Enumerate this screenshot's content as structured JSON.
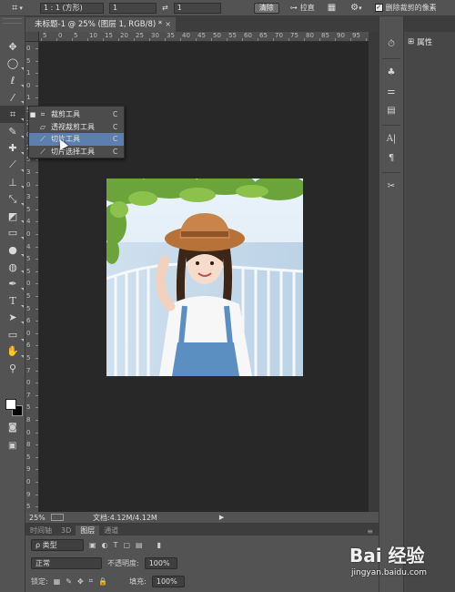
{
  "options_bar": {
    "ratio_value": "1 : 1 (方形)",
    "width_value": "1",
    "height_value": "1",
    "clear_label": "清除",
    "straighten_label": "拉直",
    "delete_cropped_label": "删除裁剪的像素"
  },
  "document": {
    "tab_title": "未标题-1 @ 25% (图层 1, RGB/8) *",
    "close_glyph": "×"
  },
  "rulers": {
    "horizontal": [
      "5",
      "0",
      "5",
      "10",
      "15",
      "20",
      "25",
      "30",
      "35",
      "40",
      "45",
      "50",
      "55",
      "60",
      "65",
      "70",
      "75",
      "80",
      "85",
      "90",
      "95",
      "100"
    ],
    "vertical": [
      "0",
      "5",
      "1",
      "0",
      "1",
      "5",
      "2",
      "0",
      "2",
      "5",
      "3",
      "0",
      "3",
      "5",
      "4",
      "0",
      "4",
      "5",
      "5",
      "0",
      "5",
      "5",
      "6",
      "0",
      "6",
      "5",
      "7",
      "0",
      "7",
      "5",
      "8",
      "0",
      "8",
      "5",
      "9",
      "0",
      "9",
      "5"
    ]
  },
  "flyout": {
    "items": [
      {
        "label": "裁剪工具",
        "key": "C",
        "selected": true
      },
      {
        "label": "透视裁剪工具",
        "key": "C",
        "selected": false
      },
      {
        "label": "切片工具",
        "key": "C",
        "selected": false
      },
      {
        "label": "切片选择工具",
        "key": "C",
        "selected": false
      }
    ]
  },
  "status": {
    "zoom": "25%",
    "doc_info": "文档:4.12M/4.12M",
    "arrow": "▶"
  },
  "bottom_panel": {
    "tabs": [
      "时间轴",
      "3D",
      "图层",
      "通道"
    ],
    "active_tab": "图层",
    "kind_label": "ρ 类型",
    "blend_mode": "正常",
    "opacity_label": "不透明度:",
    "opacity_value": "100%",
    "lock_label": "锁定:",
    "fill_label": "填充:",
    "fill_value": "100%"
  },
  "right_panel": {
    "properties_label": "属性"
  },
  "watermark": {
    "logo": "Bai 经验",
    "url": "jingyan.baidu.com"
  },
  "colors": {
    "foreground": "#ffffff",
    "background": "#000000",
    "canvas": "#282828",
    "highlight": "#5c7fb0"
  },
  "icons": {
    "toolbar": [
      "move-icon",
      "marquee-icon",
      "lasso-icon",
      "quick-select-icon",
      "crop-icon",
      "eyedropper-icon",
      "healing-icon",
      "brush-icon",
      "stamp-icon",
      "history-brush-icon",
      "eraser-icon",
      "gradient-icon",
      "blur-icon",
      "dodge-icon",
      "pen-icon",
      "type-icon",
      "path-select-icon",
      "rectangle-icon",
      "hand-icon",
      "zoom-icon"
    ]
  }
}
